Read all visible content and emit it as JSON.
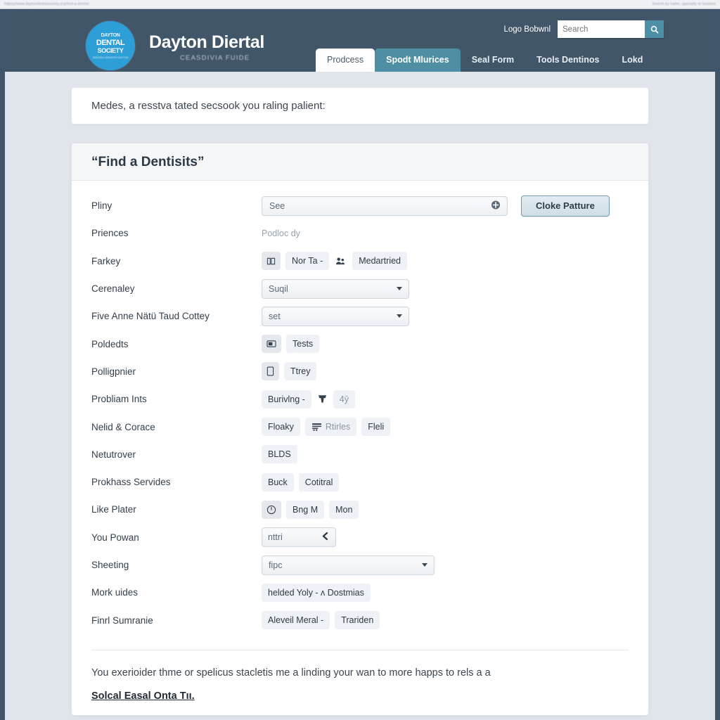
{
  "browser_chrome": {
    "left_text": "httpsy//www.daytondentalsociety.org/find-a-dentist",
    "right_text": "Search by name, specialty or location"
  },
  "header": {
    "logo": {
      "line1": "DAYTON",
      "line2": "DENTAL",
      "line3": "SOCIETY",
      "line4": "SERVING GREATER DAYTON"
    },
    "brand_title": "Dayton Diertal",
    "brand_subtitle": "CEASDIVIA FUIDE",
    "account_label": "Logo Bobwnl",
    "search": {
      "value": "",
      "placeholder": "Search",
      "button_icon": "search-icon"
    },
    "tabs": [
      {
        "label": "Prodcess",
        "state": "active"
      },
      {
        "label": "Spodt Mlurices",
        "state": "highlight"
      },
      {
        "label": "Seal Form",
        "state": "plain"
      },
      {
        "label": "Tools Dentinos",
        "state": "plain"
      },
      {
        "label": "Lokd",
        "state": "plain"
      }
    ]
  },
  "notice": {
    "text": "Medes, a resstva tated secsook you raling palient:"
  },
  "panel": {
    "title": "“Find a Dentisits”",
    "rows": [
      {
        "label": "Pliny",
        "type": "input-with-button",
        "input_value": "See",
        "input_icon": "plus-circle-icon",
        "button_label": "Cloke Patture"
      },
      {
        "label": "Priences",
        "type": "muted",
        "text": "Podloc dy"
      },
      {
        "label": "Farkey",
        "type": "chips",
        "chips": [
          {
            "label": "",
            "icon": "book-open-icon",
            "icon_only": true
          },
          {
            "label": "Nor Ta -",
            "icon": ""
          },
          {
            "label": "",
            "icon": "people-icon",
            "icon_only": true,
            "bare": true
          },
          {
            "label": "Medartried",
            "icon": ""
          }
        ]
      },
      {
        "label": "Cerenaley",
        "type": "select",
        "value": "Suqil",
        "width": "w210"
      },
      {
        "label": "Five Anne Nätü Taud Cottey",
        "type": "select",
        "value": "set",
        "width": "w210"
      },
      {
        "label": "Poldedts",
        "type": "chips",
        "chips": [
          {
            "label": "",
            "icon": "panel-icon",
            "icon_only": true
          },
          {
            "label": "Tests",
            "icon": ""
          }
        ]
      },
      {
        "label": "Polligpnier",
        "type": "chips",
        "chips": [
          {
            "label": "",
            "icon": "document-icon",
            "icon_only": true
          },
          {
            "label": "Ttrey",
            "icon": ""
          }
        ]
      },
      {
        "label": "Probliam Ints",
        "type": "chips",
        "chips": [
          {
            "label": "Burivlng -",
            "icon": ""
          },
          {
            "label": "",
            "icon": "tooth-icon",
            "icon_only": true,
            "bare": true
          },
          {
            "label": "4ȳ",
            "icon": "",
            "faint": true
          }
        ]
      },
      {
        "label": "Nelid & Corace",
        "type": "chips",
        "chips": [
          {
            "label": "Floaky",
            "icon": ""
          },
          {
            "label": "Rtirles",
            "icon": "list-icon",
            "faint": true
          },
          {
            "label": "Fleli",
            "icon": ""
          }
        ]
      },
      {
        "label": "Netutrover",
        "type": "chips",
        "chips": [
          {
            "label": "BLDS",
            "icon": ""
          }
        ]
      },
      {
        "label": "Prokhass Servides",
        "type": "chips",
        "chips": [
          {
            "label": "Buck",
            "icon": ""
          },
          {
            "label": "Cotitral",
            "icon": ""
          }
        ]
      },
      {
        "label": "Like Plater",
        "type": "chips",
        "chips": [
          {
            "label": "",
            "icon": "clock-icon",
            "icon_only": true
          },
          {
            "label": "Bng M",
            "icon": ""
          },
          {
            "label": "Mon",
            "icon": ""
          }
        ]
      },
      {
        "label": "You Powan",
        "type": "mini-input",
        "value": "nttri",
        "icon": "chevron-left-icon"
      },
      {
        "label": "Sheeting",
        "type": "select",
        "value": "fipc",
        "width": "w246"
      },
      {
        "label": "Mork uides",
        "type": "chips",
        "chips": [
          {
            "label": "helded Yoly - ʌ Dostmias",
            "icon": ""
          }
        ]
      },
      {
        "label": "Finrl Sumranie",
        "type": "chips",
        "chips": [
          {
            "label": "Aleveil Meral -",
            "icon": ""
          },
          {
            "label": "Trariden",
            "icon": ""
          }
        ]
      }
    ],
    "footer": {
      "text": "You exerioider thme or spelicus stacletis me a linding your wan to more happs to rels a a",
      "link": "Solcal Easal Onta Tιι."
    }
  },
  "colors": {
    "header_bg": "#42566a",
    "accent_teal": "#4f8fa3",
    "logo_blue": "#2e9ed6",
    "page_bg": "#dfe5ea",
    "panel_bg": "#ffffff"
  }
}
